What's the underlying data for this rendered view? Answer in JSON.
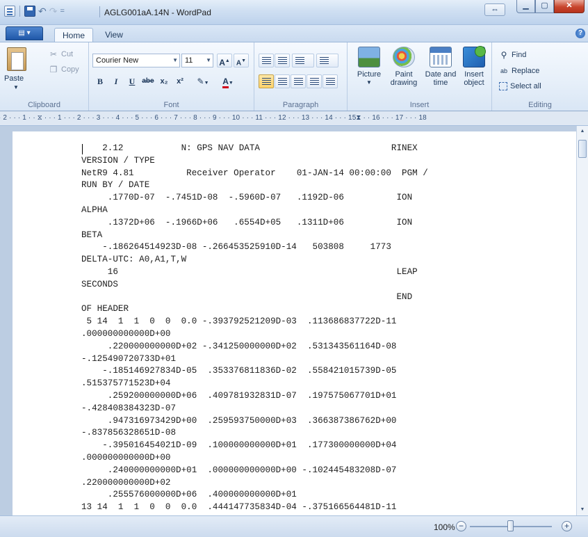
{
  "window": {
    "title": "AGLG001aA.14N - WordPad",
    "qat_dropdown": "="
  },
  "tabs": [
    {
      "label": "Home"
    },
    {
      "label": "View"
    }
  ],
  "clipboard": {
    "group_label": "Clipboard",
    "paste": "Paste",
    "cut": "Cut",
    "copy": "Copy"
  },
  "font": {
    "group_label": "Font",
    "family": "Courier New",
    "size": "11",
    "grow": "A",
    "shrink": "A",
    "bold": "B",
    "italic": "I",
    "underline": "U",
    "strikethrough": "abe",
    "subscript": "x₂",
    "superscript": "x²",
    "color_letter": "A"
  },
  "paragraph": {
    "group_label": "Paragraph"
  },
  "insert": {
    "group_label": "Insert",
    "picture": "Picture",
    "paint_line1": "Paint",
    "paint_line2": "drawing",
    "date_line1": "Date and",
    "date_line2": "time",
    "object_line1": "Insert",
    "object_line2": "object"
  },
  "editing": {
    "group_label": "Editing",
    "find": "Find",
    "replace": "Replace",
    "select_all": "Select all"
  },
  "ruler": {
    "text": "· 2 · · · 1 · · ⧖ · · · 1 · · · 2 · · · 3 · · · 4 · · · 5 · · · 6 · · · 7 · · · 8 · · · 9 · · · 10 · · · 11 · · · 12 · · · 13 · · · 14 · · · 15⧗ · · 16 · · · 17 · · · 18"
  },
  "document": {
    "lines": [
      "    2.12           N: GPS NAV DATA                         RINEX",
      "VERSION / TYPE",
      "NetR9 4.81          Receiver Operator    01-JAN-14 00:00:00  PGM /",
      "RUN BY / DATE",
      "     .1770D-07  -.7451D-08  -.5960D-07   .1192D-06          ION",
      "ALPHA",
      "     .1372D+06  -.1966D+06   .6554D+05   .1311D+06          ION",
      "BETA",
      "    -.186264514923D-08 -.266453525910D-14   503808     1773",
      "DELTA-UTC: A0,A1,T,W",
      "     16                                                     LEAP",
      "SECONDS",
      "                                                            END",
      "OF HEADER",
      " 5 14  1  1  0  0  0.0 -.393792521209D-03  .113686837722D-11",
      ".000000000000D+00",
      "     .220000000000D+02 -.341250000000D+02  .531343561164D-08",
      "-.125490720733D+01",
      "    -.185146927834D-05  .353376811836D-02  .558421015739D-05",
      ".515375771523D+04",
      "     .259200000000D+06  .409781932831D-07  .197575067701D+01",
      "-.428408384323D-07",
      "     .947316973429D+00  .259593750000D+03  .366387386762D+00",
      "-.837856328651D-08",
      "    -.395016454021D-09  .100000000000D+01  .177300000000D+04",
      ".000000000000D+00",
      "     .240000000000D+01  .000000000000D+00 -.102445483208D-07",
      ".220000000000D+02",
      "     .255576000000D+06  .400000000000D+01",
      "13 14  1  1  0  0  0.0  .444147735834D-04 -.375166564481D-11"
    ]
  },
  "status": {
    "zoom": "100%",
    "zoom_out": "−",
    "zoom_in": "+"
  }
}
